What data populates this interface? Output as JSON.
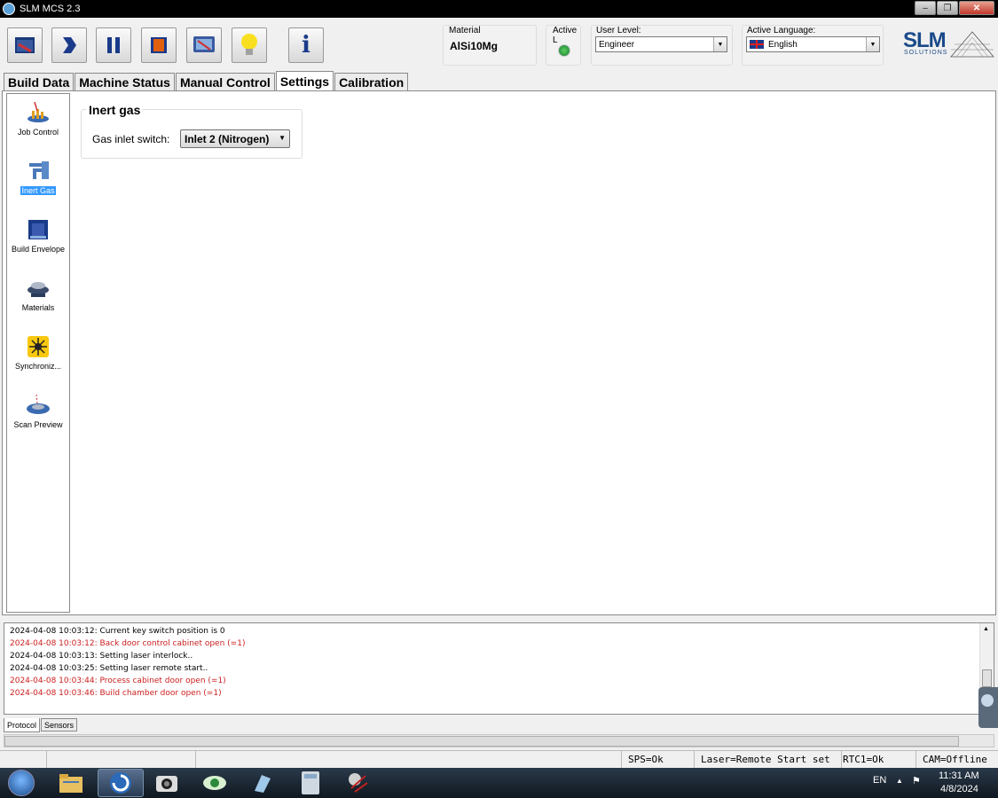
{
  "window": {
    "title": "SLM MCS 2.3",
    "minimize": "‒",
    "maximize": "❐",
    "close": "✕"
  },
  "toolbar": {
    "material_label": "Material",
    "material_value": "AlSi10Mg",
    "active_l_label": "Active L",
    "user_level_label": "User Level:",
    "user_level_value": "Engineer",
    "language_label": "Active Language:",
    "language_value": "English",
    "logo_text": "SLM",
    "logo_sub": "SOLUTIONS",
    "info_glyph": "i",
    "dropdown_arrow": "▼"
  },
  "tabs": [
    "Build Data",
    "Machine Status",
    "Manual Control",
    "Settings",
    "Calibration"
  ],
  "active_tab": "Settings",
  "sidebar": {
    "items": [
      {
        "label": "Job Control",
        "icon": "job-control-icon"
      },
      {
        "label": "Inert Gas",
        "icon": "inert-gas-icon"
      },
      {
        "label": "Build Envelope",
        "icon": "build-envelope-icon"
      },
      {
        "label": "Materials",
        "icon": "materials-icon"
      },
      {
        "label": "Synchroniz...",
        "icon": "synchronize-icon"
      },
      {
        "label": "Scan Preview",
        "icon": "scan-preview-icon"
      }
    ],
    "selected": "Inert Gas"
  },
  "inert_gas": {
    "group_title": "Inert gas",
    "inlet_label": "Gas inlet switch:",
    "inlet_value": "Inlet 2 (Nitrogen)"
  },
  "log": {
    "lines": [
      {
        "text": "2024-04-08 10:03:12: Current key switch position is 0",
        "error": false
      },
      {
        "text": "2024-04-08 10:03:12: Back door control cabinet open (=1)",
        "error": true
      },
      {
        "text": "2024-04-08 10:03:13: Setting laser interlock..",
        "error": false
      },
      {
        "text": "2024-04-08 10:03:25: Setting laser remote start..",
        "error": false
      },
      {
        "text": "2024-04-08 10:03:44: Process cabinet door open (=1)",
        "error": true
      },
      {
        "text": "2024-04-08 10:03:46: Build chamber door open (=1)",
        "error": true
      }
    ],
    "tabs": [
      "Protocol",
      "Sensors"
    ],
    "active_tab": "Protocol"
  },
  "status": {
    "sps": "SPS=Ok",
    "laser": "Laser=Remote Start set",
    "rtc": "RTC1=Ok",
    "cam": "CAM=Offline"
  },
  "taskbar": {
    "lang": "EN",
    "time": "11:31 AM",
    "date": "4/8/2024"
  },
  "colors": {
    "error_text": "#cc2020",
    "selection": "#3399ff",
    "logo_blue": "#1a4a8a"
  }
}
